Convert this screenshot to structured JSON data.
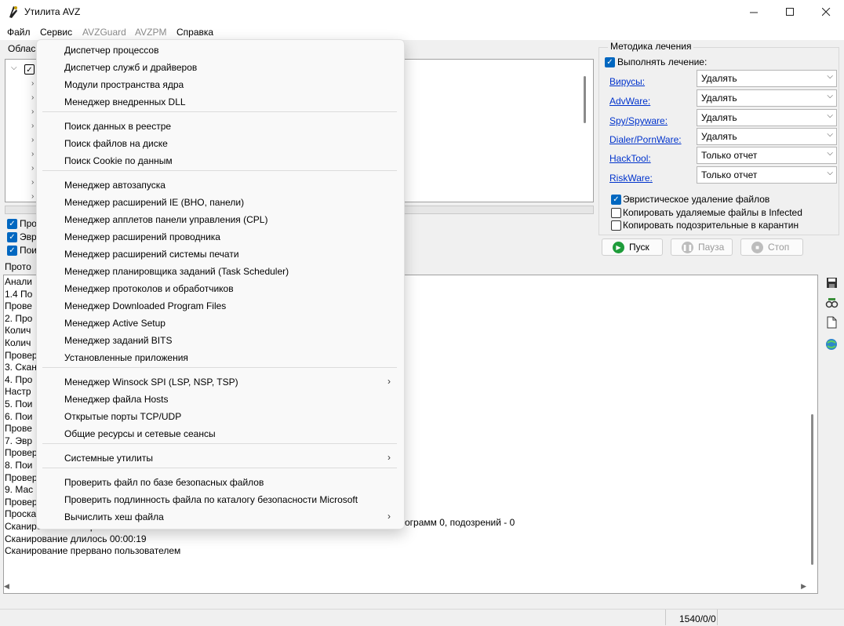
{
  "window": {
    "title": "Утилита AVZ"
  },
  "menubar": [
    {
      "label": "Файл",
      "disabled": false
    },
    {
      "label": "Сервис",
      "disabled": false
    },
    {
      "label": "AVZGuard",
      "disabled": true
    },
    {
      "label": "AVZPM",
      "disabled": true
    },
    {
      "label": "Справка",
      "disabled": false
    }
  ],
  "left_panel": {
    "area_label": "Облас",
    "options": [
      {
        "label": "Про",
        "checked": true
      },
      {
        "label": "Эвр",
        "checked": true
      },
      {
        "label": "Пои",
        "checked": true
      }
    ]
  },
  "treatment": {
    "title": "Методика лечения",
    "perform": {
      "label": "Выполнять лечение:",
      "checked": true
    },
    "rows": [
      {
        "label": "Вирусы:",
        "value": "Удалять"
      },
      {
        "label": "AdvWare:",
        "value": "Удалять"
      },
      {
        "label": "Spy/Spyware:",
        "value": "Удалять"
      },
      {
        "label": "Dialer/PornWare:",
        "value": "Удалять"
      },
      {
        "label": "HackTool:",
        "value": "Только отчет"
      },
      {
        "label": "RiskWare:",
        "value": "Только отчет"
      }
    ],
    "options": [
      {
        "label": "Эвристическое удаление файлов",
        "checked": true
      },
      {
        "label": "Копировать удаляемые файлы в  Infected",
        "checked": false
      },
      {
        "label": "Копировать подозрительные в  карантин",
        "checked": false
      }
    ],
    "buttons": {
      "start": "Пуск",
      "pause": "Пауза",
      "stop": "Стоп"
    }
  },
  "log": {
    "tab_label": "Прото",
    "lines": [
      " Анали",
      "1.4 По",
      " Прове",
      "2. Про",
      " Колич",
      " Колич",
      "Провер",
      "3. Скан",
      "4. Про",
      " Настр",
      "5. Пои",
      "6. Пои",
      " Прове",
      "7. Эвр",
      "Провер",
      "8. Пои",
      "Провер",
      "9. Мас",
      "Провер",
      "Проска",
      "Сканирование завершено в 07.11.2024 12:11:53",
      "Сканирование длилось 00:00:19",
      "Сканирование прервано пользователем"
    ],
    "overflow_text": "ограмм 0, подозрений - 0"
  },
  "status": {
    "counter": "1540/0/0"
  },
  "dropdown": {
    "groups": [
      [
        "Диспетчер процессов",
        "Диспетчер служб и драйверов",
        "Модули пространства ядра",
        "Менеджер внедренных DLL"
      ],
      [
        "Поиск данных  в реестре",
        "Поиск файлов на диске",
        "Поиск Cookie по данным"
      ],
      [
        "Менеджер автозапуска",
        "Менеджер расширений IE (BHO, панели)",
        "Менеджер апплетов панели управления (CPL)",
        "Менеджер расширений проводника",
        "Менеджер расширений системы печати",
        "Менеджер планировщика заданий (Task Scheduler)",
        "Менеджер протоколов и обработчиков",
        "Менеджер Downloaded Program Files",
        "Менеджер Active Setup",
        "Менеджер заданий BITS",
        "Установленные приложения"
      ],
      [
        "Менеджер Winsock SPI (LSP, NSP, TSP)",
        "Менеджер файла Hosts",
        "Открытые порты TCP/UDP",
        "Общие ресурсы и сетевые сеансы"
      ],
      [
        "Системные утилиты"
      ],
      [
        "Проверить файл по базе безопасных файлов",
        "Проверить подлинность файла по каталогу безопасности Microsoft",
        "Вычислить хеш файла"
      ]
    ],
    "submenu_items": [
      "Менеджер Winsock SPI (LSP, NSP, TSP)",
      "Системные утилиты",
      "Вычислить хеш файла"
    ]
  }
}
